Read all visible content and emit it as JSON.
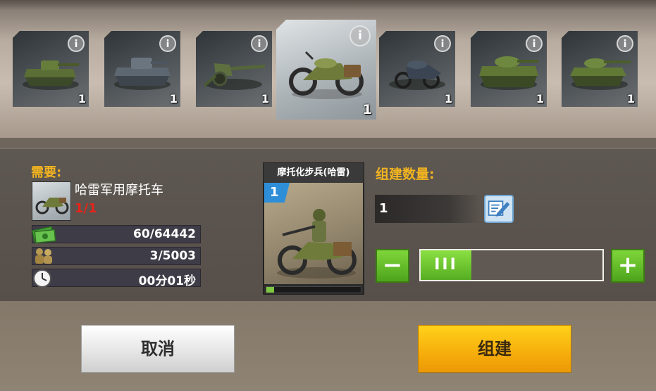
{
  "unit_bar": {
    "cards": [
      {
        "name": "light-tank",
        "count": "1",
        "info": "i",
        "selected": false
      },
      {
        "name": "panzer-tank",
        "count": "1",
        "info": "i",
        "selected": false
      },
      {
        "name": "field-gun",
        "count": "1",
        "info": "i",
        "selected": false
      },
      {
        "name": "motorcycle",
        "count": "1",
        "info": "i",
        "selected": true
      },
      {
        "name": "sidecar-motorcycle",
        "count": "1",
        "info": "i",
        "selected": false
      },
      {
        "name": "medium-tank",
        "count": "1",
        "info": "i",
        "selected": false
      },
      {
        "name": "t34-tank",
        "count": "1",
        "info": "i",
        "selected": false
      }
    ]
  },
  "requirements": {
    "label": "需要:",
    "item_name": "哈雷军用摩托车",
    "item_count": "1/1",
    "resources": [
      {
        "icon": "cash-icon",
        "value": "60/64442"
      },
      {
        "icon": "soldiers-icon",
        "value": "3/5003"
      },
      {
        "icon": "clock-icon",
        "value": "00分01秒"
      }
    ]
  },
  "unit_card": {
    "title": "摩托化步兵(哈雷)",
    "level": "1",
    "progress": 0.08
  },
  "quantity": {
    "label": "组建数量:",
    "value": "1",
    "minus": "−",
    "plus": "+",
    "handle": "III",
    "slider_fraction": 0.27
  },
  "actions": {
    "cancel": "取消",
    "build": "组建"
  },
  "colors": {
    "accent_yellow": "#f2b420",
    "red_count": "#e8231a",
    "green_button": "#62b82a",
    "build_button": "#f7b00d",
    "level_badge": "#2e8fd8"
  }
}
